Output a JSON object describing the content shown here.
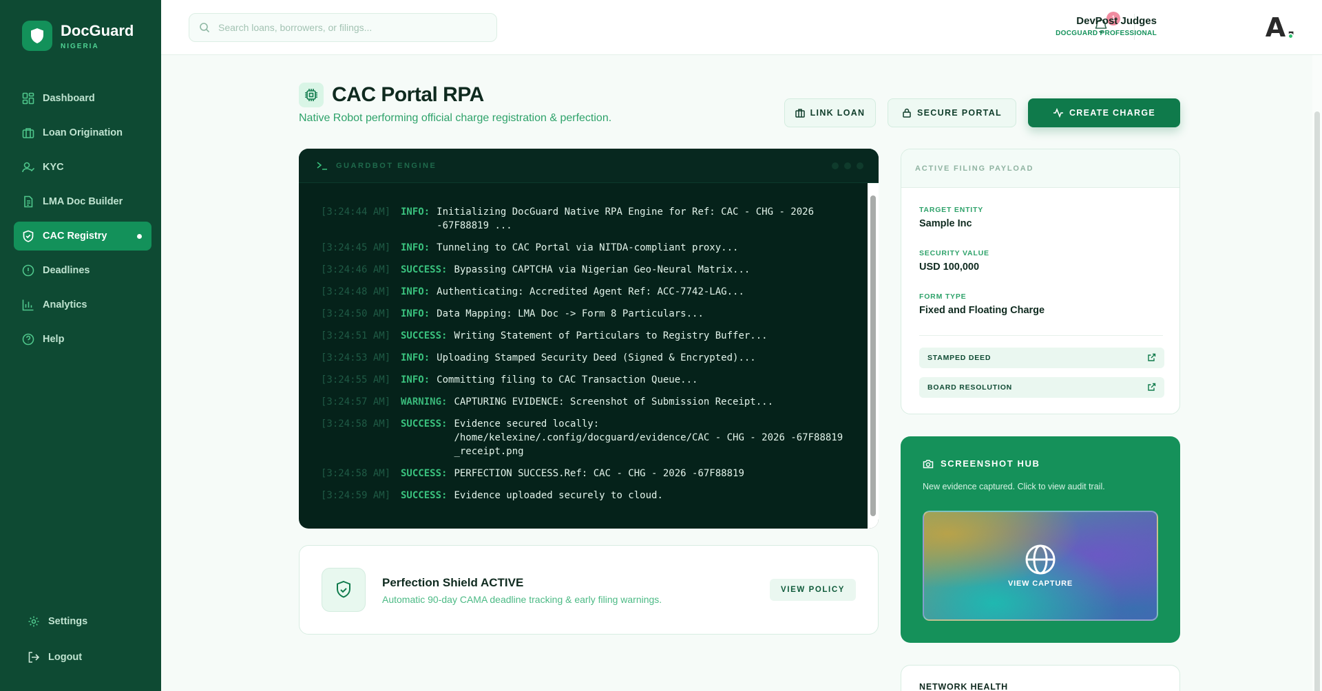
{
  "brand": {
    "name": "DocGuard",
    "region": "NIGERIA"
  },
  "sidebar": {
    "items": [
      {
        "label": "Dashboard",
        "icon": "dashboard-icon"
      },
      {
        "label": "Loan Origination",
        "icon": "briefcase-icon"
      },
      {
        "label": "KYC",
        "icon": "user-check-icon"
      },
      {
        "label": "LMA Doc Builder",
        "icon": "document-icon"
      },
      {
        "label": "CAC Registry",
        "icon": "shield-icon",
        "active": true
      },
      {
        "label": "Deadlines",
        "icon": "alert-circle-icon"
      },
      {
        "label": "Analytics",
        "icon": "bar-chart-icon"
      },
      {
        "label": "Help",
        "icon": "help-circle-icon"
      }
    ],
    "bottom": [
      {
        "label": "Settings",
        "icon": "gear-icon"
      },
      {
        "label": "Logout",
        "icon": "logout-icon"
      }
    ]
  },
  "search": {
    "placeholder": "Search loans, borrowers, or filings..."
  },
  "notifications": {
    "count": "1"
  },
  "user": {
    "name": "DevPost Judges",
    "role": "DOCGUARD PROFESSIONAL",
    "avatar_letter": "A."
  },
  "page": {
    "title": "CAC Portal RPA",
    "subtitle": "Native Robot performing official charge registration & perfection."
  },
  "actions": {
    "link_loan": "LINK LOAN",
    "secure_portal": "SECURE PORTAL",
    "create_charge": "CREATE CHARGE"
  },
  "terminal": {
    "title": "GUARDBOT ENGINE",
    "logs": [
      {
        "time": "[3:24:44 AM]",
        "level": "INFO:",
        "message": "Initializing DocGuard Native RPA Engine for Ref: CAC - CHG - 2026 -67F88819 ..."
      },
      {
        "time": "[3:24:45 AM]",
        "level": "INFO:",
        "message": "Tunneling to CAC Portal via NITDA-compliant proxy..."
      },
      {
        "time": "[3:24:46 AM]",
        "level": "SUCCESS:",
        "message": "Bypassing CAPTCHA via Nigerian Geo-Neural Matrix..."
      },
      {
        "time": "[3:24:48 AM]",
        "level": "INFO:",
        "message": "Authenticating: Accredited Agent Ref: ACC-7742-LAG..."
      },
      {
        "time": "[3:24:50 AM]",
        "level": "INFO:",
        "message": "Data Mapping: LMA Doc -> Form 8 Particulars..."
      },
      {
        "time": "[3:24:51 AM]",
        "level": "SUCCESS:",
        "message": "Writing Statement of Particulars to Registry Buffer..."
      },
      {
        "time": "[3:24:53 AM]",
        "level": "INFO:",
        "message": "Uploading Stamped Security Deed (Signed & Encrypted)..."
      },
      {
        "time": "[3:24:55 AM]",
        "level": "INFO:",
        "message": "Committing filing to CAC Transaction Queue..."
      },
      {
        "time": "[3:24:57 AM]",
        "level": "WARNING:",
        "message": "CAPTURING EVIDENCE: Screenshot of Submission Receipt..."
      },
      {
        "time": "[3:24:58 AM]",
        "level": "SUCCESS:",
        "message": "Evidence secured locally: /home/kelexine/.config/docguard/evidence/CAC - CHG - 2026 -67F88819 _receipt.png"
      },
      {
        "time": "[3:24:58 AM]",
        "level": "SUCCESS:",
        "message": "PERFECTION SUCCESS.Ref: CAC - CHG - 2026 -67F88819"
      },
      {
        "time": "[3:24:59 AM]",
        "level": "SUCCESS:",
        "message": "Evidence uploaded securely to cloud."
      }
    ]
  },
  "shield": {
    "title": "Perfection Shield ACTIVE",
    "subtitle": "Automatic 90-day CAMA deadline tracking & early filing warnings.",
    "button": "VIEW POLICY"
  },
  "payload": {
    "header": "ACTIVE FILING PAYLOAD",
    "target_entity_label": "TARGET ENTITY",
    "target_entity": "Sample Inc",
    "security_value_label": "SECURITY VALUE",
    "security_value": "USD 100,000",
    "form_type_label": "FORM TYPE",
    "form_type": "Fixed and Floating Charge",
    "docs": [
      "STAMPED DEED",
      "BOARD RESOLUTION"
    ]
  },
  "hub": {
    "title": "SCREENSHOT HUB",
    "subtitle": "New evidence captured. Click to view audit trail.",
    "capture_label": "VIEW CAPTURE"
  },
  "network": {
    "title": "NETWORK HEALTH"
  },
  "colors": {
    "sidebar": "#0e4a33",
    "accent": "#13915a",
    "primary_button": "#0f7a4b",
    "terminal_bg": "#05221a"
  }
}
